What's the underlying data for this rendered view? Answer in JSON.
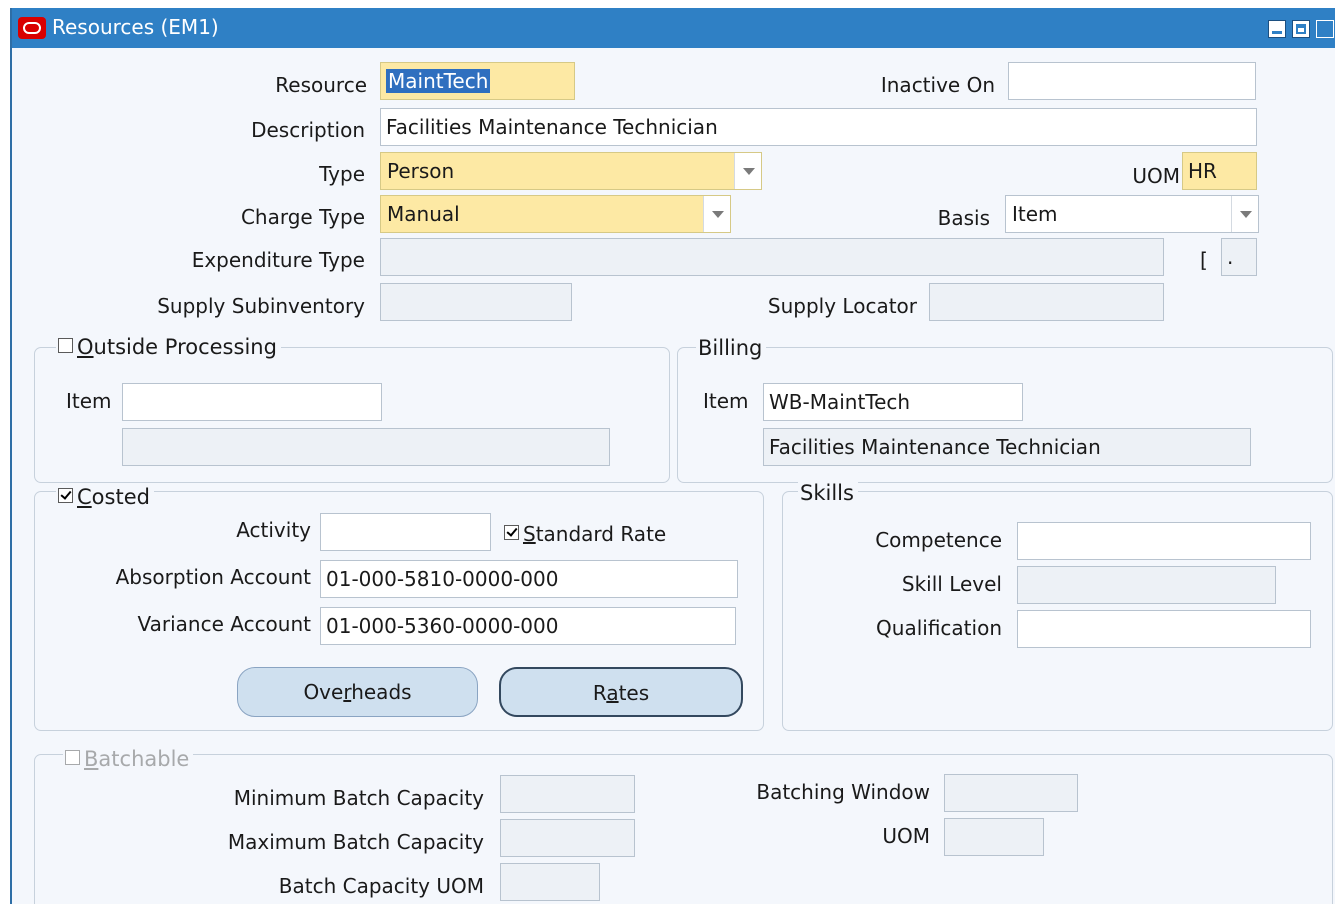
{
  "window": {
    "title": "Resources (EM1)"
  },
  "resource": {
    "resource_label": "Resource",
    "resource_value": "MaintTech",
    "inactive_on_label": "Inactive On",
    "inactive_on_value": "",
    "description_label": "Description",
    "description_value": "Facilities Maintenance Technician",
    "type_label": "Type",
    "type_value": "Person",
    "uom_label": "UOM",
    "uom_value": "HR",
    "charge_type_label": "Charge Type",
    "charge_type_value": "Manual",
    "basis_label": "Basis",
    "basis_value": "Item",
    "expenditure_type_label": "Expenditure Type",
    "expenditure_type_value": "",
    "bracket_text": "[",
    "small_field_value": ".",
    "supply_subinventory_label": "Supply Subinventory",
    "supply_subinventory_value": "",
    "supply_locator_label": "Supply Locator",
    "supply_locator_value": ""
  },
  "outside_processing": {
    "title_u": "O",
    "title_rest": "utside Processing",
    "checked": false,
    "item_label": "Item",
    "item_value": "",
    "item_desc_value": ""
  },
  "billing": {
    "title": "Billing",
    "item_label": "Item",
    "item_value": "WB-MaintTech",
    "item_desc_value": "Facilities Maintenance Technician"
  },
  "costed": {
    "title_u": "C",
    "title_rest": "osted",
    "checked": true,
    "activity_label": "Activity",
    "activity_value": "",
    "standard_rate_u": "S",
    "standard_rate_rest": "tandard Rate",
    "standard_rate_checked": true,
    "absorption_label": "Absorption Account",
    "absorption_value": "01-000-5810-0000-000",
    "variance_label": "Variance Account",
    "variance_value": "01-000-5360-0000-000",
    "overheads_pre": "Ove",
    "overheads_u": "r",
    "overheads_post": "heads",
    "rates_pre": "R",
    "rates_u": "a",
    "rates_post": "tes"
  },
  "skills": {
    "title": "Skills",
    "competence_label": "Competence",
    "competence_value": "",
    "skill_level_label": "Skill Level",
    "skill_level_value": "",
    "qualification_label": "Qualification",
    "qualification_value": ""
  },
  "batchable": {
    "title_u": "B",
    "title_rest": "atchable",
    "checked": false,
    "min_label": "Minimum Batch Capacity",
    "min_value": "",
    "max_label": "Maximum Batch Capacity",
    "max_value": "",
    "uom_label": "Batch Capacity UOM",
    "uom_value": "",
    "window_label": "Batching Window",
    "window_value": "",
    "uom2_label": "UOM",
    "uom2_value": ""
  }
}
